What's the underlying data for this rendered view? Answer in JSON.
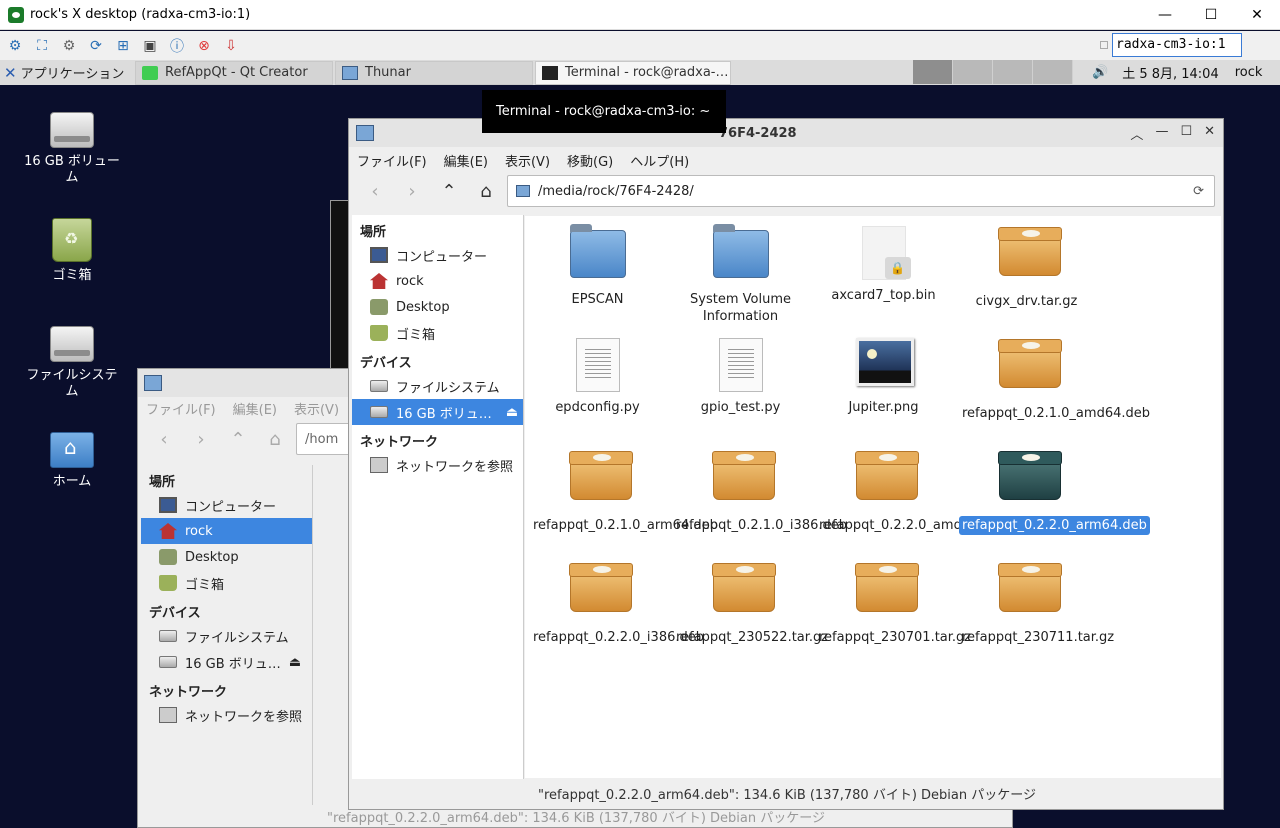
{
  "vnc": {
    "title": "rock's X desktop (radxa-cm3-io:1)",
    "minimize": "—",
    "maximize": "☐",
    "close": "✕",
    "host_field": "radxa-cm3-io:1"
  },
  "panel": {
    "applications": "アプリケーション",
    "tasks": [
      {
        "label": "RefAppQt - Qt Creator"
      },
      {
        "label": "Thunar"
      },
      {
        "label": "Terminal - rock@radxa-…"
      }
    ],
    "tray_text": "土  5  8月, 14:04",
    "user": "rock",
    "volume_icon": "🔊"
  },
  "desktop": {
    "icons": [
      {
        "label": "16 GB ボリューム"
      },
      {
        "label": "ゴミ箱"
      },
      {
        "label": "ファイルシステム"
      },
      {
        "label": "ホーム"
      }
    ]
  },
  "tooltip": "Terminal - rock@radxa-cm3-io: ~",
  "back_window": {
    "menu": [
      "ファイル(F)",
      "編集(E)",
      "表示(V)"
    ],
    "location": "/hom",
    "sections": {
      "places": "場所",
      "devices": "デバイス",
      "network": "ネットワーク"
    },
    "places": [
      "コンピューター",
      "rock",
      "Desktop",
      "ゴミ箱"
    ],
    "devices": [
      "ファイルシステム",
      "16 GB ボリュ…"
    ],
    "network": [
      "ネットワークを参照"
    ],
    "status": "\"refappqt_0.2.2.0_arm64.deb\": 134.6 KiB (137,780 バイト) Debian パッケージ"
  },
  "front_window": {
    "title": "76F4-2428",
    "menu": [
      "ファイル(F)",
      "編集(E)",
      "表示(V)",
      "移動(G)",
      "ヘルプ(H)"
    ],
    "location": "/media/rock/76F4-2428/",
    "sections": {
      "places": "場所",
      "devices": "デバイス",
      "network": "ネットワーク"
    },
    "places": [
      "コンピューター",
      "rock",
      "Desktop",
      "ゴミ箱"
    ],
    "devices": [
      "ファイルシステム",
      "16 GB ボリュ…"
    ],
    "network": [
      "ネットワークを参照"
    ],
    "files": [
      {
        "name": "EPSCAN",
        "type": "folder"
      },
      {
        "name": "System Volume Information",
        "type": "folder"
      },
      {
        "name": "axcard7_top.bin",
        "type": "locked"
      },
      {
        "name": "civgx_drv.tar.gz",
        "type": "archive"
      },
      {
        "name": "epdconfig.py",
        "type": "text"
      },
      {
        "name": "gpio_test.py",
        "type": "text"
      },
      {
        "name": "Jupiter.png",
        "type": "image"
      },
      {
        "name": "refappqt_0.2.1.0_amd64.deb",
        "type": "archive"
      },
      {
        "name": "refappqt_0.2.1.0_arm64.deb",
        "type": "archive"
      },
      {
        "name": "refappqt_0.2.1.0_i386.deb",
        "type": "archive"
      },
      {
        "name": "refappqt_0.2.2.0_amd64.deb",
        "type": "archive"
      },
      {
        "name": "refappqt_0.2.2.0_arm64.deb",
        "type": "archive",
        "selected": true
      },
      {
        "name": "refappqt_0.2.2.0_i386.deb",
        "type": "archive"
      },
      {
        "name": "refappqt_230522.tar.gz",
        "type": "archive"
      },
      {
        "name": "refappqt_230701.tar.gz",
        "type": "archive"
      },
      {
        "name": "refappqt_230711.tar.gz",
        "type": "archive"
      }
    ],
    "status": "\"refappqt_0.2.2.0_arm64.deb\": 134.6 KiB (137,780 バイト) Debian パッケージ"
  }
}
